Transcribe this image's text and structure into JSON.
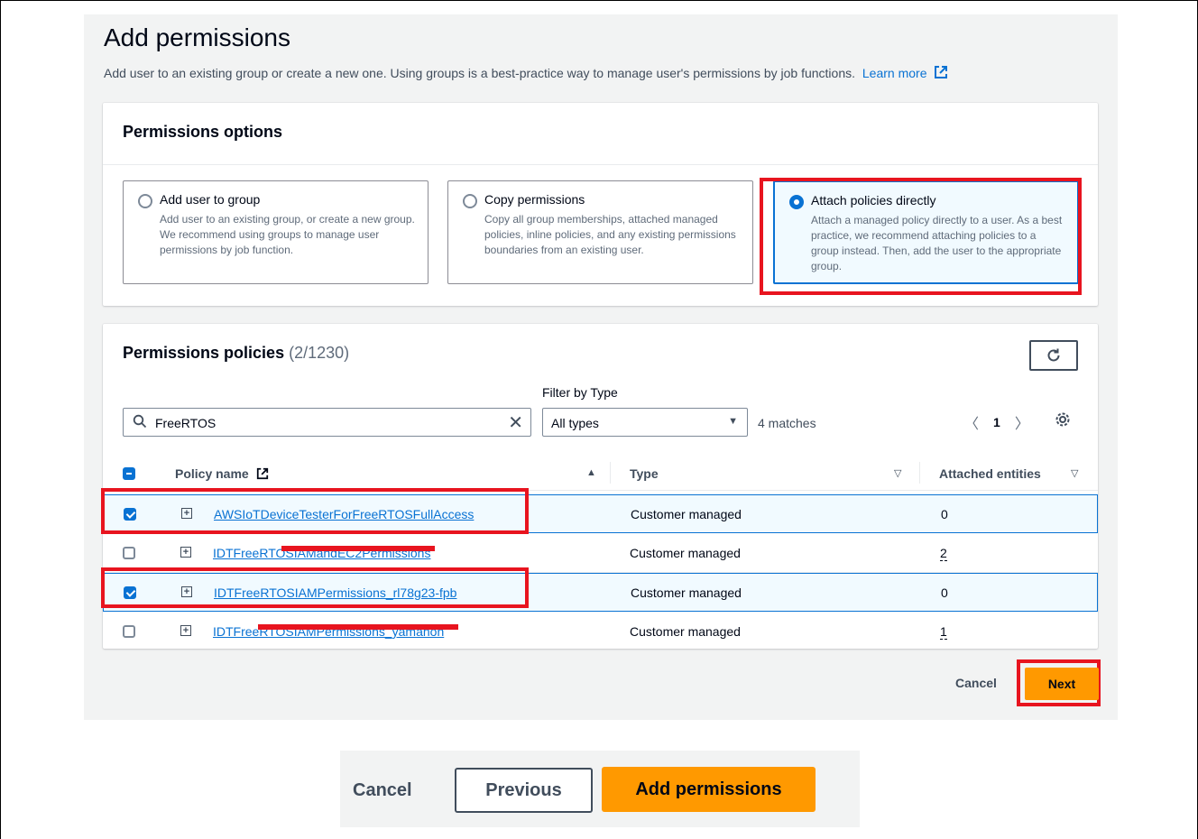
{
  "header": {
    "title": "Add permissions",
    "description": "Add user to an existing group or create a new one. Using groups is a best-practice way to manage user's permissions by job functions.",
    "learn_more": "Learn more"
  },
  "options": {
    "title": "Permissions options",
    "tiles": [
      {
        "label": "Add user to group",
        "desc": "Add user to an existing group, or create a new group. We recommend using groups to manage user permissions by job function.",
        "selected": false
      },
      {
        "label": "Copy permissions",
        "desc": "Copy all group memberships, attached managed policies, inline policies, and any existing permissions boundaries from an existing user.",
        "selected": false
      },
      {
        "label": "Attach policies directly",
        "desc": "Attach a managed policy directly to a user. As a best practice, we recommend attaching policies to a group instead. Then, add the user to the appropriate group.",
        "selected": true
      }
    ]
  },
  "policies": {
    "title": "Permissions policies",
    "count": "(2/1230)",
    "filter_label": "Filter by Type",
    "search_value": "FreeRTOS",
    "type_value": "All types",
    "matches": "4 matches",
    "page": "1",
    "columns": {
      "name": "Policy name",
      "type": "Type",
      "entities": "Attached entities"
    },
    "rows": [
      {
        "name": "AWSIoTDeviceTesterForFreeRTOSFullAccess",
        "type": "Customer managed",
        "entities": "0",
        "checked": true
      },
      {
        "name": "IDTFreeRTOSIAMandEC2Permissions",
        "type": "Customer managed",
        "entities": "2",
        "checked": false
      },
      {
        "name": "IDTFreeRTOSIAMPermissions_rl78g23-fpb",
        "type": "Customer managed",
        "entities": "0",
        "checked": true
      },
      {
        "name": "IDTFreeRTOSIAMPermissions_yamahon",
        "type": "Customer managed",
        "entities": "1",
        "checked": false
      }
    ]
  },
  "footer": {
    "cancel": "Cancel",
    "next": "Next"
  },
  "bottom": {
    "cancel": "Cancel",
    "previous": "Previous",
    "add": "Add permissions"
  },
  "colors": {
    "accent": "#0972d3",
    "primary_button": "#ff9900",
    "annotation_red": "#e8141f"
  }
}
